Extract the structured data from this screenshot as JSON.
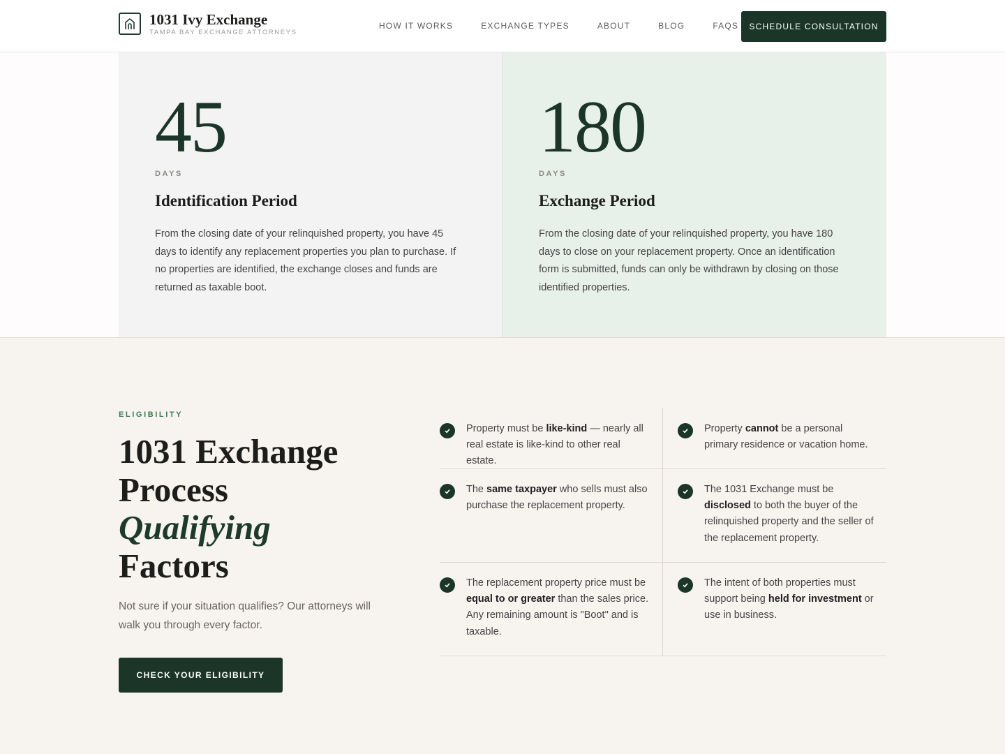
{
  "header": {
    "brand_title": "1031 Ivy Exchange",
    "brand_subtitle": "TAMPA BAY EXCHANGE ATTORNEYS",
    "logo_icon": "house-arch-icon",
    "nav": [
      {
        "label": "HOW IT WORKS"
      },
      {
        "label": "EXCHANGE TYPES"
      },
      {
        "label": "ABOUT"
      },
      {
        "label": "BLOG"
      },
      {
        "label": "FAQS"
      }
    ],
    "cta_label": "SCHEDULE CONSULTATION"
  },
  "periods": [
    {
      "number": "45",
      "unit": "DAYS",
      "title": "Identification Period",
      "description": "From the closing date of your relinquished property, you have 45 days to identify any replacement properties you plan to purchase. If no properties are identified, the exchange closes and funds are returned as taxable boot."
    },
    {
      "number": "180",
      "unit": "DAYS",
      "title": "Exchange Period",
      "description": "From the closing date of your relinquished property, you have 180 days to close on your replacement property. Once an identification form is submitted, funds can only be withdrawn by closing on those identified properties."
    }
  ],
  "eligibility": {
    "eyebrow": "ELIGIBILITY",
    "headline_line1": "1031 Exchange",
    "headline_line2": "Process",
    "headline_italic": "Qualifying",
    "headline_line4": "Factors",
    "lede": "Not sure if your situation qualifies? Our attorneys will walk you through every factor.",
    "button_label": "CHECK YOUR ELIGIBILITY",
    "factors": [
      {
        "pre": "Property must be ",
        "bold": "like-kind",
        "post": " — nearly all real estate is like-kind to other real estate."
      },
      {
        "pre": "Property ",
        "bold": "cannot",
        "post": " be a personal primary residence or vacation home."
      },
      {
        "pre": "The ",
        "bold": "same taxpayer",
        "post": " who sells must also purchase the replacement property."
      },
      {
        "pre": "The 1031 Exchange must be ",
        "bold": "disclosed",
        "post": " to both the buyer of the relinquished property and the seller of the replacement property."
      },
      {
        "pre": "The replacement property price must be ",
        "bold": "equal to or greater",
        "post": " than the sales price. Any remaining amount is \"Boot\" and is taxable."
      },
      {
        "pre": "The intent of both properties must support being ",
        "bold": "held for investment",
        "post": " or use in business."
      }
    ],
    "check_icon": "check-circle-icon"
  },
  "colors": {
    "brand_green": "#1b3628",
    "accent_green": "#3d7a54",
    "card_grey": "#f4f3f4",
    "card_mint": "#e8f0ea",
    "section_bg": "#f7f4f0"
  }
}
